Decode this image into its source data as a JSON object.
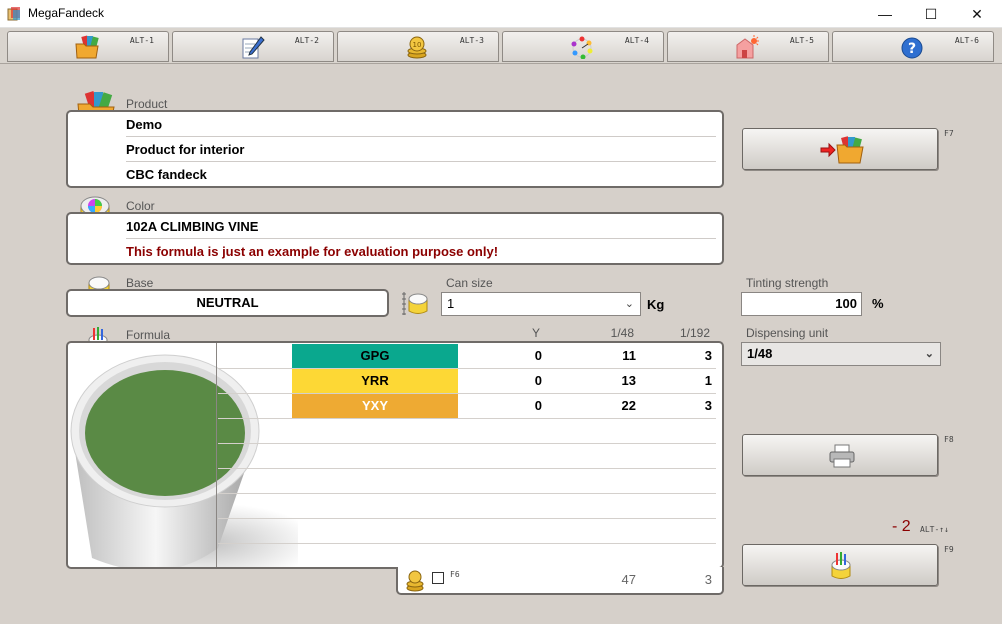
{
  "window": {
    "title": "MegaFandeck",
    "minimize": "—",
    "maximize": "☐",
    "close": "✕"
  },
  "tabs": [
    {
      "icon": "folder-cards-icon",
      "key": "ALT-1"
    },
    {
      "icon": "pen-paper-icon",
      "key": "ALT-2"
    },
    {
      "icon": "coins-icon",
      "key": "ALT-3"
    },
    {
      "icon": "color-wheel-icon",
      "key": "ALT-4"
    },
    {
      "icon": "house-sun-icon",
      "key": "ALT-5"
    },
    {
      "icon": "help-icon",
      "key": "ALT-6"
    }
  ],
  "product": {
    "label": "Product",
    "lines": [
      "Demo",
      "Product for interior",
      "CBC fandeck"
    ]
  },
  "color": {
    "label": "Color",
    "name": "102A CLIMBING VINE",
    "note": "This formula is just an example for evaluation purpose only!"
  },
  "base": {
    "label": "Base",
    "value": "NEUTRAL"
  },
  "can_size": {
    "label": "Can size",
    "value": "1",
    "unit": "Kg"
  },
  "tinting": {
    "label": "Tinting strength",
    "value": "100",
    "unit": "%"
  },
  "dispensing": {
    "label": "Dispensing unit",
    "value": "1/48"
  },
  "formula": {
    "label": "Formula",
    "headers": [
      "Y",
      "1/48",
      "1/192"
    ],
    "rows": [
      {
        "name": "GPG",
        "y": "0",
        "c48": "11",
        "c192": "3",
        "color": "#0aa88e",
        "text": "#000000"
      },
      {
        "name": "YRR",
        "y": "0",
        "c48": "13",
        "c192": "1",
        "color": "#fdd835",
        "text": "#000000"
      },
      {
        "name": "YXY",
        "y": "0",
        "c48": "22",
        "c192": "3",
        "color": "#eeaa33",
        "text": "#ffffff"
      }
    ],
    "footer_key": "F6",
    "total_48": "47",
    "total_192": "3"
  },
  "buttons": {
    "open_key": "F7",
    "print_key": "F8",
    "dispense_key": "F9"
  },
  "counter": {
    "value": "- 2",
    "key": "ALT-↑↓"
  },
  "colors": {
    "paint": "#5a8a45",
    "accent_red": "#8b0000"
  }
}
